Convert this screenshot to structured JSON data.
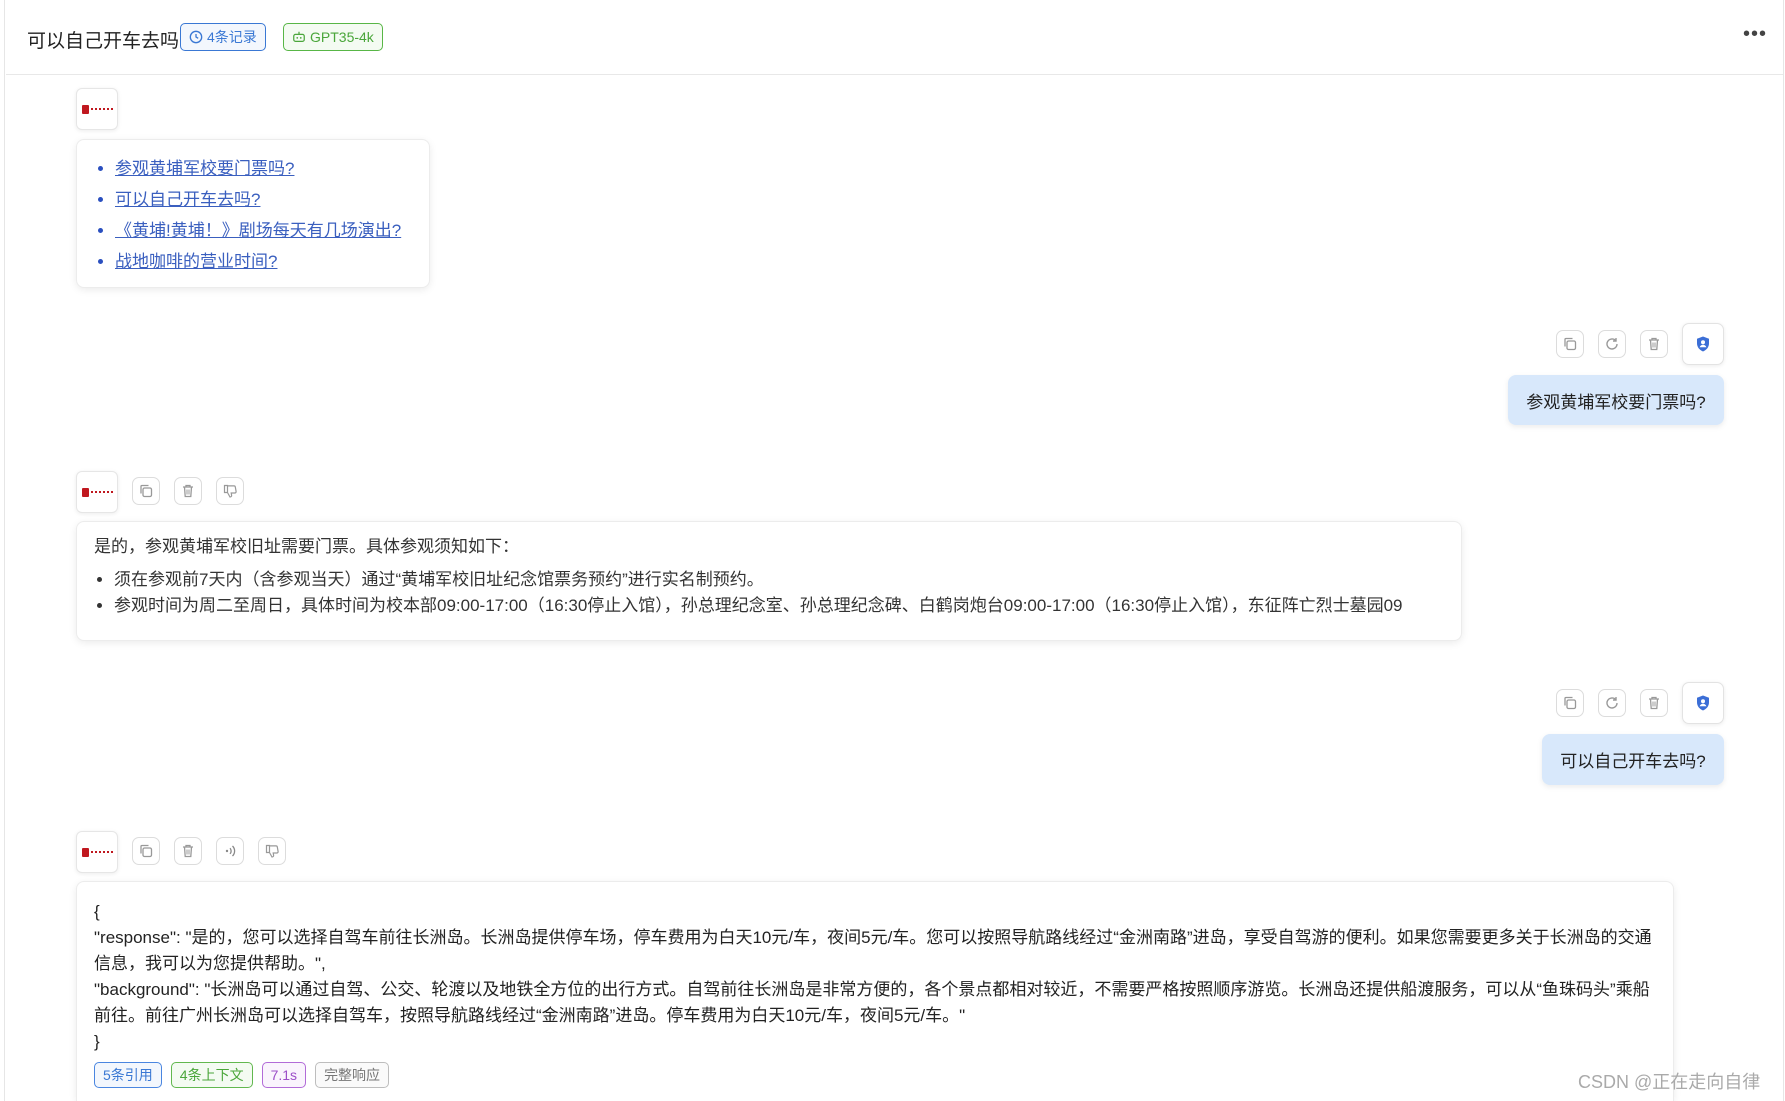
{
  "header": {
    "title": "可以自己开车去吗",
    "records_tag": "4条记录",
    "model_tag": "GPT35-4k",
    "more_label": "•••"
  },
  "suggested_questions": [
    "参观黄埔军校要门票吗?",
    "可以自己开车去吗?",
    "《黄埔!黄埔！》剧场每天有几场演出?",
    "战地咖啡的营业时间?"
  ],
  "messages": {
    "user1": "参观黄埔军校要门票吗?",
    "answer1": {
      "intro": "是的，参观黄埔军校旧址需要门票。具体参观须知如下：",
      "items": [
        "须在参观前7天内（含参观当天）通过“黄埔军校旧址纪念馆票务预约”进行实名制预约。",
        "参观时间为周二至周日，具体时间为校本部09:00-17:00（16:30停止入馆），孙总理纪念室、孙总理纪念碑、白鹤岗炮台09:00-17:00（16:30停止入馆），东征阵亡烈士墓园09"
      ]
    },
    "user2": "可以自己开车去吗?",
    "answer2": {
      "json_text": "{\n\"response\": \"是的，您可以选择自驾车前往长洲岛。长洲岛提供停车场，停车费用为白天10元/车，夜间5元/车。您可以按照导航路线经过“金洲南路”进岛，享受自驾游的便利。如果您需要更多关于长洲岛的交通信息，我可以为您提供帮助。\",\n\"background\": \"长洲岛可以通过自驾、公交、轮渡以及地铁全方位的出行方式。自驾前往长洲岛是非常方便的，各个景点都相对较近，不需要严格按照顺序游览。长洲岛还提供船渡服务，可以从“鱼珠码头”乘船前往。前往广州长洲岛可以选择自驾车，按照导航路线经过“金洲南路”进岛。停车费用为白天10元/车，夜间5元/车。\"\n}",
      "meta": {
        "citations": "5条引用",
        "context": "4条上下文",
        "time": "7.1s",
        "full_response": "完整响应"
      }
    }
  },
  "icons": {
    "copy": "copy-icon",
    "refresh": "refresh-icon",
    "delete": "trash-icon",
    "dislike": "thumbs-down-icon",
    "speak": "speaker-icon",
    "user": "user-shield-icon",
    "clock": "clock-icon",
    "robot": "robot-icon"
  },
  "colors": {
    "accent_blue": "#3a78d4",
    "accent_green": "#4aa63a",
    "user_bubble": "#d8e8fb",
    "logo_red": "#c0181f"
  },
  "watermark": "CSDN @正在走向自律"
}
